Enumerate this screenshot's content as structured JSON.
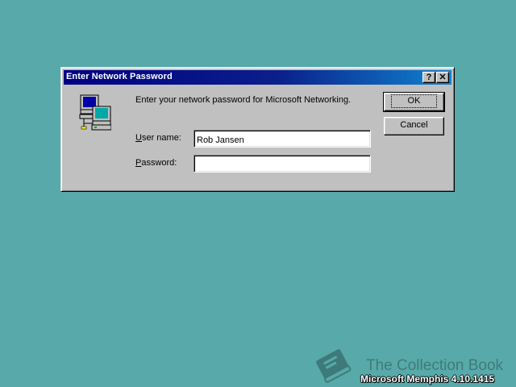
{
  "dialog": {
    "title": "Enter Network Password",
    "help_glyph": "?",
    "close_glyph": "✕",
    "icon": "network-computers-icon",
    "prompt": "Enter your network password for Microsoft Networking.",
    "username_label_accel": "U",
    "username_label_rest": "ser name:",
    "username_value": "Rob Jansen",
    "password_label_accel": "P",
    "password_label_rest": "assword:",
    "password_value": "",
    "ok_label": "OK",
    "cancel_label": "Cancel"
  },
  "desktop": {
    "background_color": "#58aaaa"
  },
  "watermark": {
    "icon": "book-icon",
    "title": "The Collection Book",
    "build": "Microsoft Memphis 4.10.1415"
  }
}
